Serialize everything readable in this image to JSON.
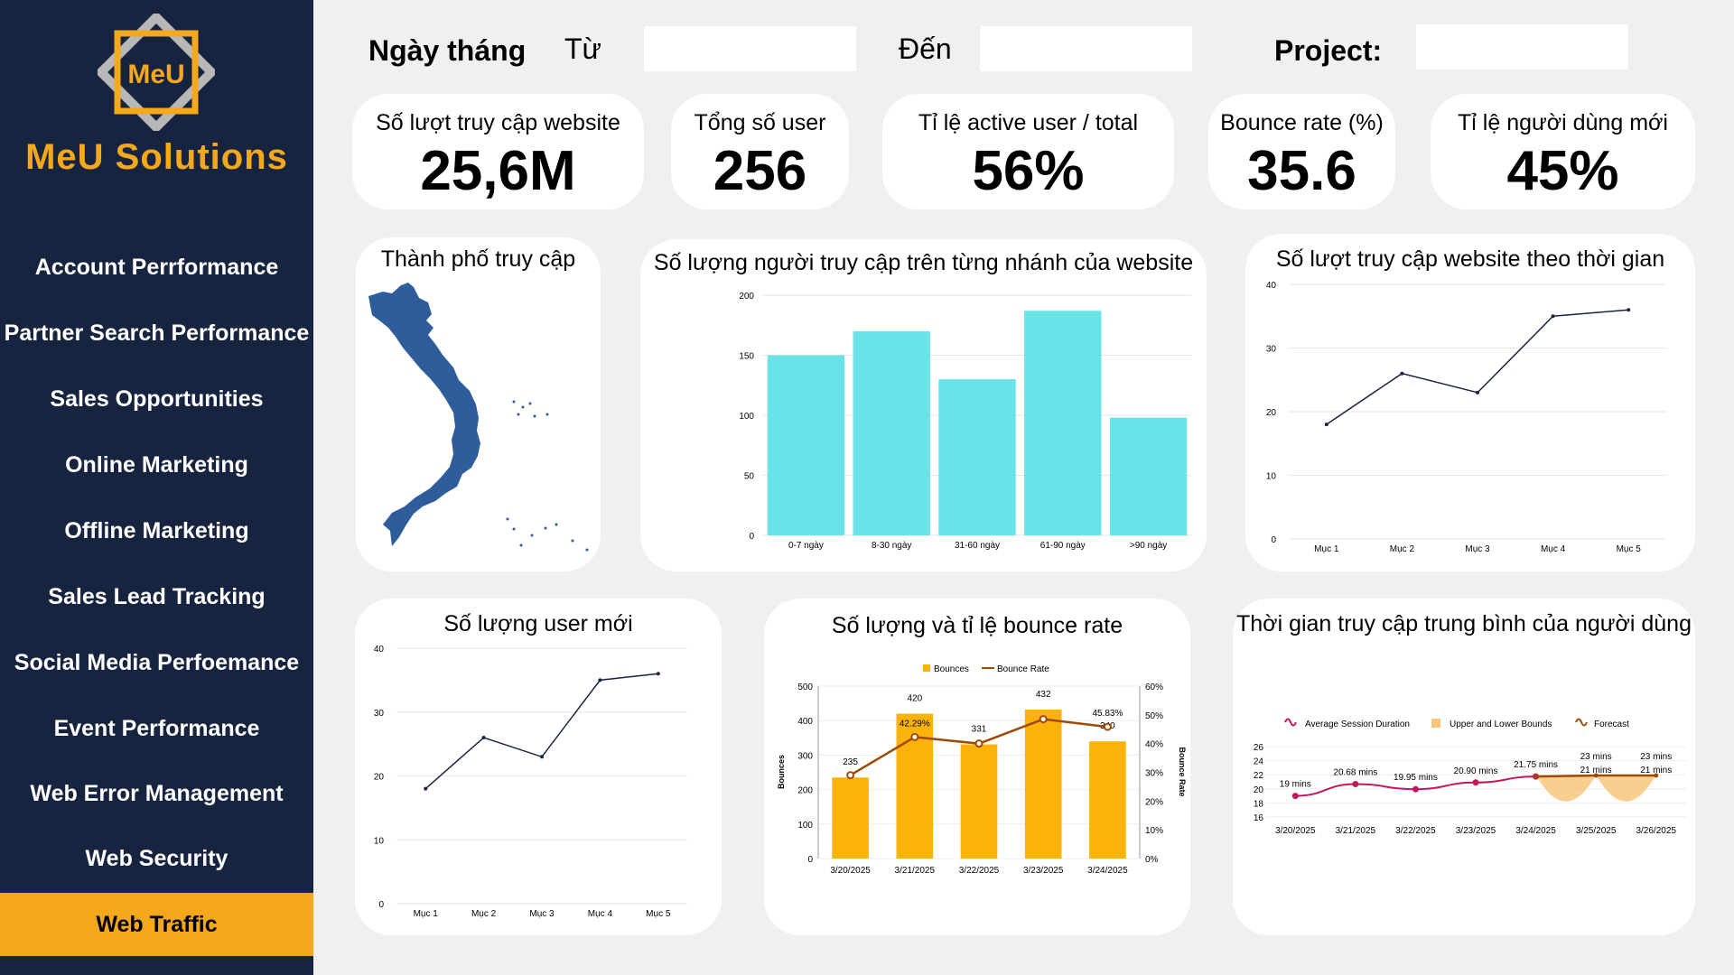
{
  "brand": {
    "logo_text": "MeU",
    "name": "MeU Solutions"
  },
  "nav": {
    "items": [
      "Account Perrformance",
      "Partner Search Performance",
      "Sales Opportunities",
      "Online Marketing",
      "Offline Marketing",
      "Sales Lead Tracking",
      "Social Media Perfoemance",
      "Event Performance",
      "Web Error Management",
      "Web Security",
      "Web Traffic"
    ],
    "active": "Web Traffic"
  },
  "filters": {
    "date_label": "Ngày tháng",
    "from_label": "Từ",
    "to_label": "Đến",
    "project_label": "Project:",
    "from_value": "",
    "to_value": "",
    "project_value": ""
  },
  "kpis": [
    {
      "label": "Số lượt truy cập website",
      "value": "25,6M"
    },
    {
      "label": "Tổng số user",
      "value": "256"
    },
    {
      "label": "Tỉ lệ active user / total",
      "value": "56%"
    },
    {
      "label": "Bounce rate (%)",
      "value": "35.6"
    },
    {
      "label": "Tỉ lệ người dùng mới",
      "value": "45%"
    }
  ],
  "colors": {
    "sidebar": "#17243f",
    "accent": "#f5a81c",
    "map": "#2f5d9b",
    "bar_cyan": "#6ae3e8",
    "bounce_bar": "#fbb30b",
    "bounce_line": "#9c4a06",
    "session_line": "#c2185b",
    "bounds": "#f8c67a"
  },
  "map_title": "Thành phố truy cập",
  "chart_data": [
    {
      "id": "branch",
      "type": "bar",
      "title": "Số lượng người truy cập trên từng nhánh của website",
      "categories": [
        "0-7 ngày",
        "8-30 ngày",
        "31-60 ngày",
        "61-90 ngày",
        ">90 ngày"
      ],
      "values": [
        150,
        170,
        130,
        187,
        98
      ],
      "ylim": [
        0,
        200
      ],
      "yticks": [
        0,
        50,
        100,
        150,
        200
      ],
      "grid": true
    },
    {
      "id": "visits_time",
      "type": "line",
      "title": "Số lượt truy cập website theo thời gian",
      "categories": [
        "Mục 1",
        "Mục 2",
        "Mục 3",
        "Mục 4",
        "Mục 5"
      ],
      "values": [
        18,
        26,
        23,
        35,
        36
      ],
      "ylim": [
        0,
        40
      ],
      "yticks": [
        0,
        10,
        20,
        30,
        40
      ],
      "grid": true
    },
    {
      "id": "new_users",
      "type": "line",
      "title": "Số lượng user mới",
      "categories": [
        "Mục 1",
        "Mục 2",
        "Mục 3",
        "Mục 4",
        "Mục 5"
      ],
      "values": [
        18,
        26,
        23,
        35,
        36
      ],
      "ylim": [
        0,
        40
      ],
      "yticks": [
        0,
        10,
        20,
        30,
        40
      ],
      "grid": true
    },
    {
      "id": "bounce",
      "type": "bar",
      "title": "Số lượng và tỉ lệ bounce rate",
      "categories": [
        "3/20/2025",
        "3/21/2025",
        "3/22/2025",
        "3/23/2025",
        "3/24/2025"
      ],
      "series": [
        {
          "name": "Bounces",
          "values": [
            235,
            420,
            331,
            432,
            340
          ],
          "labels": [
            "235",
            "420",
            "331",
            "432",
            "340"
          ]
        },
        {
          "name": "Bounce Rate",
          "values": [
            29,
            42.29,
            40,
            48.5,
            45.83
          ],
          "labels": [
            "",
            "42.29%",
            "",
            "",
            "45.83%"
          ]
        }
      ],
      "ylabel": "Bounces",
      "y2label": "Bounce Rate",
      "ylim": [
        0,
        500
      ],
      "yticks": [
        0,
        100,
        200,
        300,
        400,
        500
      ],
      "y2lim": [
        0,
        60
      ],
      "y2ticks": [
        "0%",
        "10%",
        "20%",
        "30%",
        "40%",
        "50%",
        "60%"
      ],
      "legend": "top"
    },
    {
      "id": "session",
      "type": "line",
      "title": "Thời gian truy cập trung bình của người dùng",
      "categories": [
        "3/20/2025",
        "3/21/2025",
        "3/22/2025",
        "3/23/2025",
        "3/24/2025",
        "3/25/2025",
        "3/26/2025"
      ],
      "series": [
        {
          "name": "Average Session Duration",
          "values": [
            19,
            20.68,
            19.95,
            20.9,
            21.75
          ],
          "labels": [
            "19 mins",
            "20.68 mins",
            "19.95 mins",
            "20.90 mins",
            "21.75 mins"
          ]
        },
        {
          "name": "Upper and Lower Bounds",
          "upper": [
            23,
            23
          ],
          "lower": [
            17,
            17
          ]
        },
        {
          "name": "Forecast",
          "values": [
            21.75,
            21.9,
            21.9
          ],
          "labels": [
            "",
            "23 mins",
            "23 mins"
          ],
          "labels_low": [
            "",
            "21 mins",
            "21 mins"
          ]
        }
      ],
      "ylim": [
        16,
        26
      ],
      "yticks": [
        16,
        18,
        20,
        22,
        24,
        26
      ],
      "legend": "top"
    }
  ]
}
